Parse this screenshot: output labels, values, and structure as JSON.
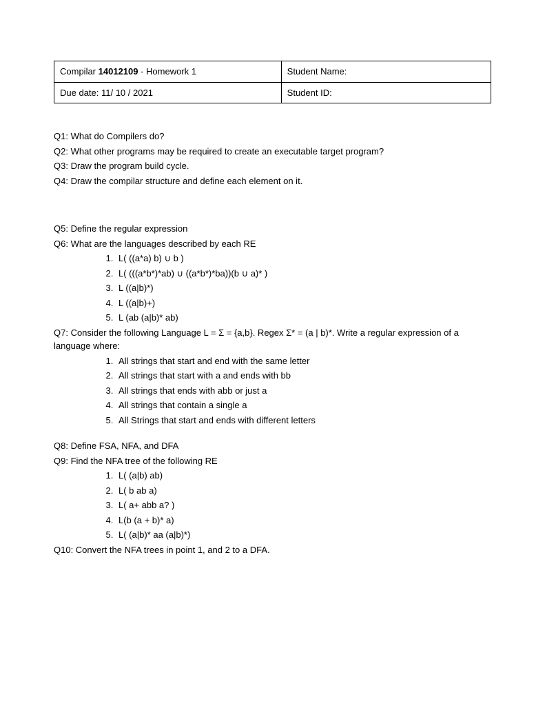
{
  "header": {
    "course_prefix": "Compilar ",
    "course_code": "14012109",
    "course_suffix": " - Homework 1",
    "student_name_label": "Student Name:",
    "due_date_label": "Due date: 11/ 10 / 2021",
    "student_id_label": "Student ID:"
  },
  "questions": {
    "q1": "Q1: What do Compilers do?",
    "q2": "Q2: What other programs may be required to create an executable target program?",
    "q3": "Q3: Draw the program build cycle.",
    "q4": "Q4: Draw the compilar structure and define each element on it.",
    "q5": "Q5: Define the regular expression",
    "q6": "Q6: What are the languages described by each RE",
    "q6_items": [
      "L( ((a*a) b) ∪ b )",
      "L( (((a*b*)*ab) ∪ ((a*b*)*ba))(b ∪ a)* )",
      "L ((a|b)*)",
      "L ((a|b)+)",
      "L (ab (a|b)* ab)"
    ],
    "q7": "Q7: Consider the following Language L = Σ = {a,b}. Regex Σ* = (a | b)*. Write a regular expression of a language where:",
    "q7_items": [
      "All strings that start and end with the same letter",
      "All strings that start with a and ends with bb",
      "All strings that ends with abb or just a",
      "All strings that contain a single a",
      "All Strings that start and ends with different letters"
    ],
    "q8": "Q8: Define FSA, NFA, and DFA",
    "q9": "Q9: Find the NFA tree of the following RE",
    "q9_items": [
      "L( (a|b) ab)",
      "L( b ab a)",
      "L( a+ abb a? )",
      "L(b (a + b)* a)",
      "L( (a|b)* aa  (a|b)*)"
    ],
    "q10": "Q10: Convert the NFA trees in point 1, and 2 to a DFA."
  }
}
